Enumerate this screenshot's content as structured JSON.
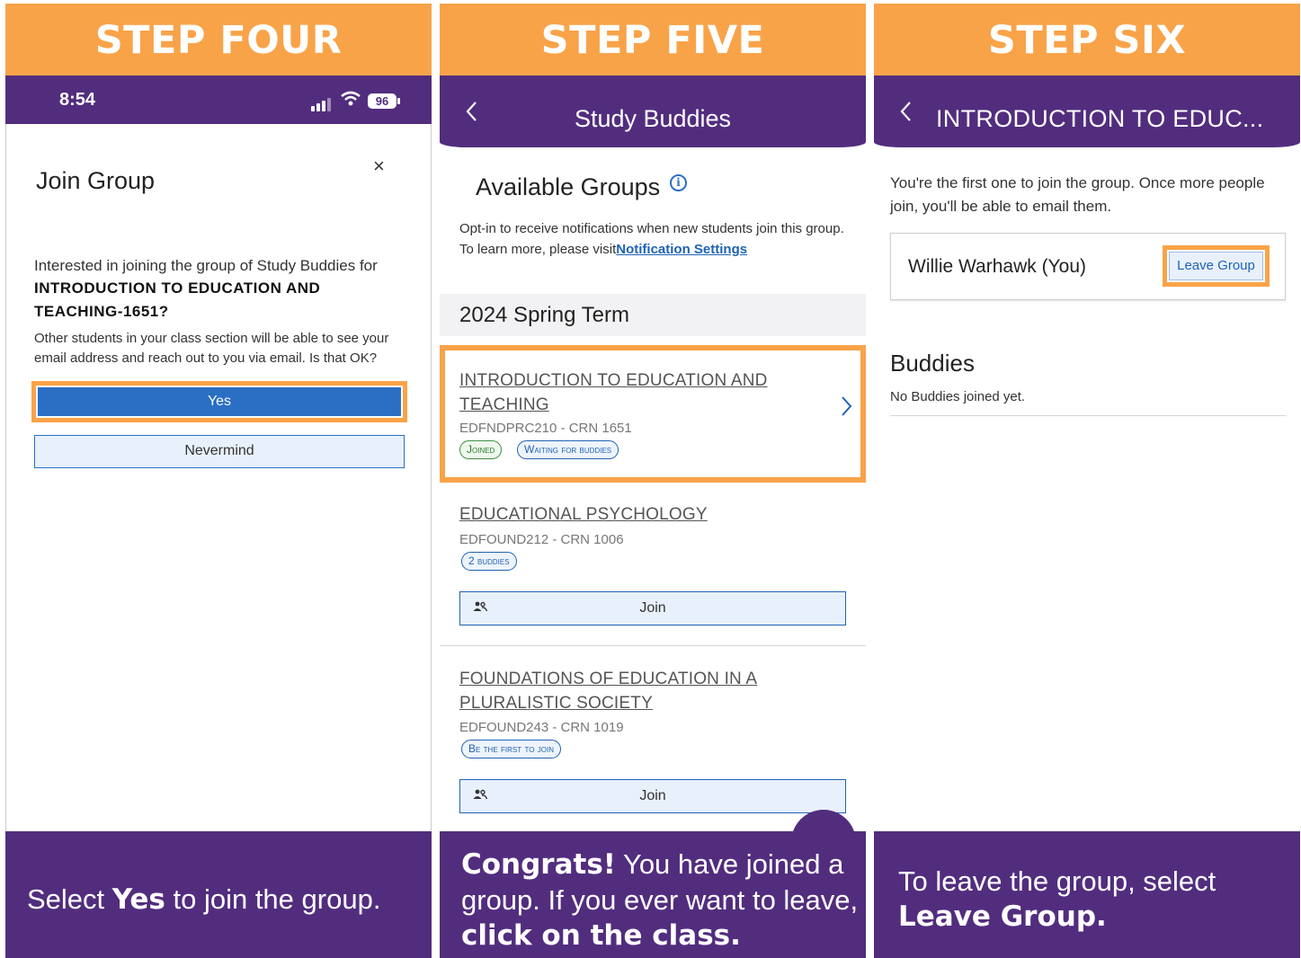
{
  "panels": {
    "step4": {
      "header": "STEP FOUR",
      "status": {
        "time": "8:54",
        "battery": "96"
      },
      "dialog": {
        "title": "Join Group",
        "close_icon": "×",
        "question": "Interested in joining the group of Study Buddies for",
        "course": "INTRODUCTION TO EDUCATION AND TEACHING-1651?",
        "note": "Other students in your class section will be able to see your email address and reach out to you via email. Is that OK?",
        "yes_label": "Yes",
        "nevermind_label": "Nevermind"
      },
      "caption": {
        "pre": "Select ",
        "bold": "Yes",
        "post": " to join the group."
      }
    },
    "step5": {
      "header": "STEP FIVE",
      "nav": {
        "back_icon": "chevron-left-icon",
        "title": "Study Buddies"
      },
      "available_title": "Available Groups",
      "optin_text": "Opt-in to receive notifications when new students join this group. To learn more, please visit",
      "optin_link": "Notification Settings",
      "term": "2024 Spring Term",
      "courses": [
        {
          "title": "INTRODUCTION TO EDUCATION AND TEACHING",
          "code": "EDFNDPRC210 - CRN 1651",
          "chips": [
            "Joined",
            "Waiting for buddies"
          ]
        },
        {
          "title": "EDUCATIONAL PSYCHOLOGY",
          "code": "EDFOUND212 - CRN 1006",
          "chips": [
            "2 buddies"
          ],
          "join_label": "Join"
        },
        {
          "title": "FOUNDATIONS OF EDUCATION IN A PLURALISTIC SOCIETY",
          "code": "EDFOUND243 - CRN 1019",
          "chips": [
            "Be the first to join"
          ],
          "join_label": "Join"
        }
      ],
      "caption": {
        "bold1": "Congrats!",
        "mid": " You have joined a group. If you ever want to leave, ",
        "bold2": "click on the class."
      }
    },
    "step6": {
      "header": "STEP SIX",
      "nav": {
        "back_icon": "chevron-left-icon",
        "title": "INTRODUCTION TO EDUC..."
      },
      "first_msg": "You're the first one to join the group. Once more people join, you'll be able to email them.",
      "member_name": "Willie Warhawk (You)",
      "leave_label": "Leave Group",
      "buddies_title": "Buddies",
      "buddies_empty": "No Buddies joined yet.",
      "caption": {
        "pre": "To leave the group, select ",
        "bold": "Leave Group."
      }
    }
  },
  "colors": {
    "orange": "#f9a349",
    "purple": "#522d7e",
    "blue": "#2a6fc4"
  }
}
